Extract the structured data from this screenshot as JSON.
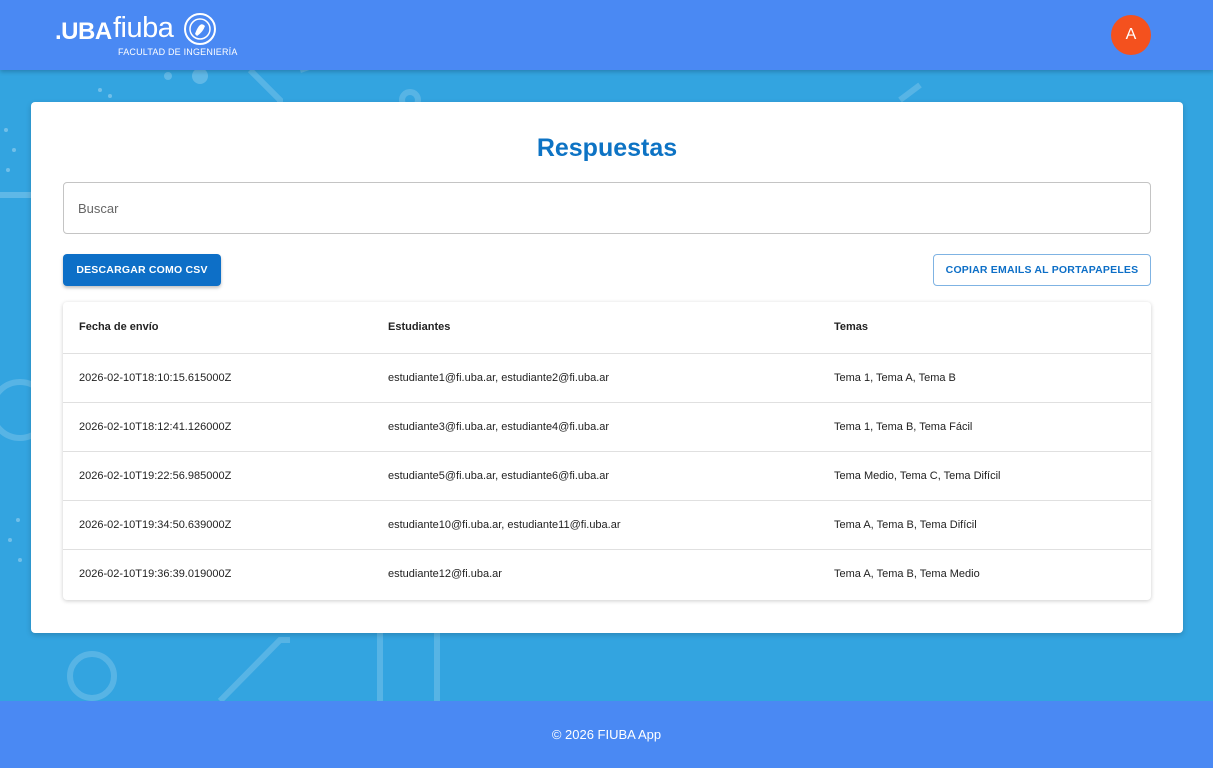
{
  "header": {
    "logo_uba": ".UBA",
    "logo_fiuba": "fiuba",
    "logo_sub": "FACULTAD DE INGENIERÍA",
    "avatar_initial": "A"
  },
  "main": {
    "title": "Respuestas",
    "search_placeholder": "Buscar",
    "download_csv_label": "DESCARGAR COMO CSV",
    "copy_emails_label": "COPIAR EMAILS AL PORTAPAPELES"
  },
  "table": {
    "columns": [
      "Fecha de envío",
      "Estudiantes",
      "Temas"
    ],
    "rows": [
      [
        "2026-02-10T18:10:15.615000Z",
        "estudiante1@fi.uba.ar, estudiante2@fi.uba.ar",
        "Tema 1, Tema A, Tema B"
      ],
      [
        "2026-02-10T18:12:41.126000Z",
        "estudiante3@fi.uba.ar, estudiante4@fi.uba.ar",
        "Tema 1, Tema B, Tema Fácil"
      ],
      [
        "2026-02-10T19:22:56.985000Z",
        "estudiante5@fi.uba.ar, estudiante6@fi.uba.ar",
        "Tema Medio, Tema C, Tema Difícil"
      ],
      [
        "2026-02-10T19:34:50.639000Z",
        "estudiante10@fi.uba.ar, estudiante11@fi.uba.ar",
        "Tema A, Tema B, Tema Difícil"
      ],
      [
        "2026-02-10T19:36:39.019000Z",
        "estudiante12@fi.uba.ar",
        "Tema A, Tema B, Tema Medio"
      ]
    ]
  },
  "footer": {
    "text": "© 2026 FIUBA App"
  },
  "colors": {
    "header_bg": "#4a89f3",
    "page_bg": "#33a4e0",
    "title": "#0d73c4",
    "primary_button": "#0d6fc7",
    "avatar": "#f4511e"
  }
}
